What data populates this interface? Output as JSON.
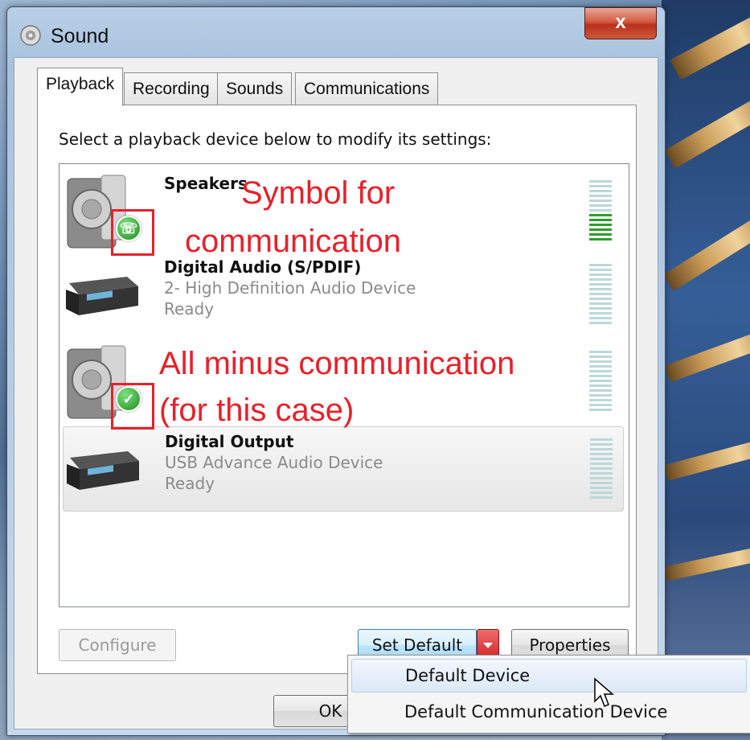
{
  "window": {
    "title": "Sound",
    "close_label": "x"
  },
  "tabs": [
    {
      "label": "Playback",
      "active": true
    },
    {
      "label": "Recording",
      "active": false
    },
    {
      "label": "Sounds",
      "active": false
    },
    {
      "label": "Communications",
      "active": false
    }
  ],
  "instruction": "Select a playback device below to modify its settings:",
  "devices": [
    {
      "name": "Speakers",
      "line1": "",
      "line2": "",
      "icon": "speaker-icon",
      "badge": "phone-icon",
      "meter_level": 0.4
    },
    {
      "name": "Digital Audio (S/PDIF)",
      "line1": "2- High Definition Audio Device",
      "line2": "Ready",
      "icon": "receiver-icon",
      "badge": "",
      "meter_level": 0
    },
    {
      "name": "",
      "line1": "",
      "line2": "",
      "icon": "speaker-icon",
      "badge": "check-icon",
      "meter_level": 0
    },
    {
      "name": "Digital Output",
      "line1": "USB Advance Audio Device",
      "line2": "Ready",
      "icon": "receiver-icon",
      "badge": "",
      "meter_level": 0
    }
  ],
  "annotations": {
    "top_line1": "Symbol for",
    "top_line2": "communication",
    "bottom_line1": "All minus communication",
    "bottom_line2": "(for this case)",
    "color": "#e8202a"
  },
  "buttons": {
    "configure": "Configure",
    "set_default": "Set Default",
    "properties": "Properties",
    "ok": "OK"
  },
  "menu": {
    "items": [
      "Default Device",
      "Default Communication Device"
    ]
  },
  "colors": {
    "meter_on": "#2e9c2e",
    "meter_off": "#bcd7d9",
    "close_red": "#c9402a"
  }
}
